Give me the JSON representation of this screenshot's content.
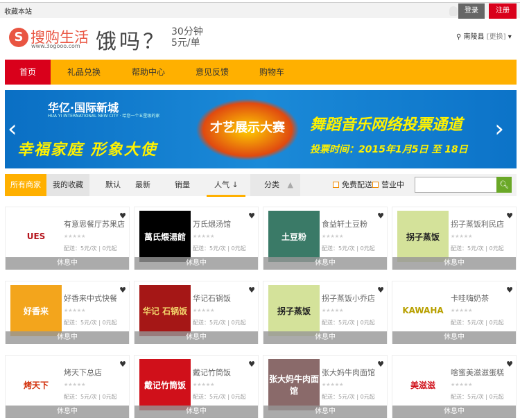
{
  "topbar": {
    "favorite": "收藏本站",
    "login": "登录",
    "register": "注册"
  },
  "logo": {
    "name": "搜购生活",
    "url": "www.3ogooo.com",
    "mark": "S"
  },
  "slogan": {
    "main": "饿吗？",
    "line1": "30分钟",
    "line2": "5元/单"
  },
  "location": {
    "city": "南陵县",
    "change": "[更换]"
  },
  "nav": [
    "首页",
    "礼品兑换",
    "帮助中心",
    "意见反馈",
    "购物车"
  ],
  "banner": {
    "brand": "华亿·国际新城",
    "brand_sub": "HUA YI INTERNATIONAL NEW CITY · 给您一个五星级的家",
    "left": "幸福家庭  形象大使",
    "center": "才艺展示大赛",
    "right": "舞蹈音乐网络投票通道",
    "date": "投票时间：2015年1月5日 至 18日"
  },
  "filter": {
    "all": "所有商家",
    "fav": "我的收藏",
    "default": "默认",
    "newest": "最新",
    "sales": "销量",
    "popular": "人气",
    "category": "分类",
    "free": "免费配送",
    "open": "营业中",
    "search_placeholder": ""
  },
  "shops": [
    {
      "name": "有意思餐厅苏果店",
      "logo": "UES",
      "bg": "#ffffff",
      "fg": "#b5141c",
      "fee": "配送：5元/次 | 0元起",
      "status": "休息中"
    },
    {
      "name": "万氏煨汤馆",
      "logo": "萬氏煨湯館",
      "bg": "#000000",
      "fg": "#ffffff",
      "fee": "配送：5元/次 | 0元起",
      "status": "休息中"
    },
    {
      "name": "食益轩土豆粉",
      "logo": "土豆粉",
      "bg": "#3a7a67",
      "fg": "#ffffff",
      "fee": "配送：5元/次 | 0元起",
      "status": "休息中"
    },
    {
      "name": "拐子蒸饭利民店",
      "logo": "拐子蒸饭",
      "bg": "#d4e29a",
      "fg": "#222222",
      "fee": "配送：5元/次 | 0元起",
      "status": "休息中"
    },
    {
      "name": "好香来中式快餐",
      "logo": "好香来",
      "bg": "#f3a51c",
      "fg": "#ffffff",
      "fee": "配送：5元/次 | 0元起",
      "status": "休息中"
    },
    {
      "name": "华记石锅饭",
      "logo": "华记 石锅饭",
      "bg": "#a51716",
      "fg": "#f2d36b",
      "fee": "配送：5元/次 | 0元起",
      "status": "休息中"
    },
    {
      "name": "拐子蒸饭小乔店",
      "logo": "拐子蒸饭",
      "bg": "#d4e29a",
      "fg": "#222222",
      "fee": "配送：5元/次 | 0元起",
      "status": "休息中"
    },
    {
      "name": "卡哇嗨奶茶",
      "logo": "KAWAHA",
      "bg": "#ffffff",
      "fg": "#b8a000",
      "fee": "配送：5元/次 | 0元起",
      "status": "休息中"
    },
    {
      "name": "烤天下总店",
      "logo": "烤天下",
      "bg": "#ffffff",
      "fg": "#d2300a",
      "fee": "配送：5元/次 | 0元起",
      "status": "休息中"
    },
    {
      "name": "戴记竹筒饭",
      "logo": "戴记竹筒饭",
      "bg": "#d0101a",
      "fg": "#ffffff",
      "fee": "配送：5元/次 | 0元起",
      "status": "休息中"
    },
    {
      "name": "张大妈牛肉面馆",
      "logo": "张大妈牛肉面馆",
      "bg": "#8a6a6a",
      "fg": "#ffffff",
      "fee": "配送：5元/次 | 0元起",
      "status": "休息中"
    },
    {
      "name": "啥蜜美滋滋蛋糕",
      "logo": "美滋滋",
      "bg": "#ffffff",
      "fg": "#d0101a",
      "fee": "配送：5元/次 | 0元起",
      "status": "休息中"
    }
  ]
}
